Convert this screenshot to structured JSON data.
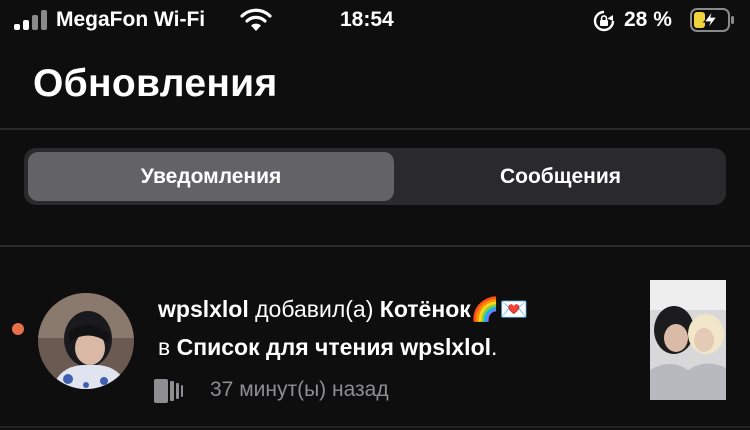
{
  "status_bar": {
    "carrier": "MegaFon Wi-Fi",
    "time": "18:54",
    "battery_percent": "28 %",
    "battery_level": 0.28,
    "icons": [
      "signal-icon",
      "wifi-icon",
      "rotation-lock-icon",
      "battery-charging-icon"
    ]
  },
  "header": {
    "title": "Обновления"
  },
  "tabs": [
    {
      "label": "Уведомления",
      "active": true
    },
    {
      "label": "Сообщения",
      "active": false
    }
  ],
  "notification": {
    "user": "wpslxlol",
    "action": "добавил(а)",
    "story": "Котёнок🌈💌",
    "preposition": "в",
    "list": "Список для чтения wpslxlol",
    "period": ".",
    "time_ago": "37 минут(ы) назад",
    "unread": true,
    "icon": "reading-list-icon"
  },
  "colors": {
    "background": "#0e0e0f",
    "segment_bg": "#2a2a2d",
    "segment_active": "#636366",
    "unread_dot": "#e6704a",
    "secondary_text": "#8e8e93"
  }
}
